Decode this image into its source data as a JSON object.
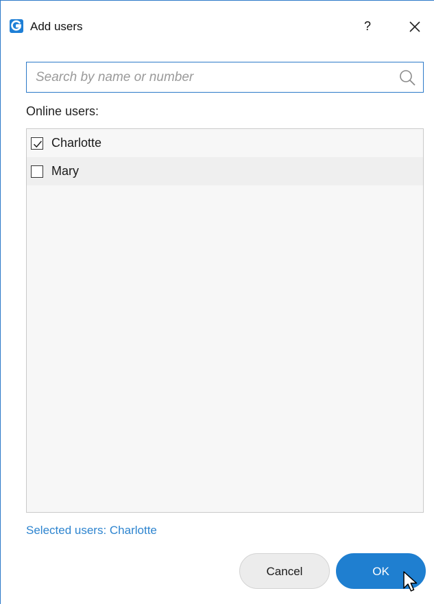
{
  "window": {
    "title": "Add users",
    "help_label": "?"
  },
  "search": {
    "value": "",
    "placeholder": "Search by name or number"
  },
  "list": {
    "heading": "Online users:",
    "items": [
      {
        "label": "Charlotte",
        "checked": true
      },
      {
        "label": "Mary",
        "checked": false
      }
    ]
  },
  "selection": {
    "prefix": "Selected users: ",
    "names": "Charlotte"
  },
  "buttons": {
    "cancel": "Cancel",
    "ok": "OK"
  },
  "colors": {
    "accent": "#1f7fd0",
    "link": "#2d84cf",
    "border_focus": "#2b79c8"
  },
  "icons": {
    "app": "app-logo-icon",
    "close": "close-icon",
    "search": "search-icon",
    "check": "checkmark-icon",
    "cursor": "mouse-pointer-icon"
  }
}
